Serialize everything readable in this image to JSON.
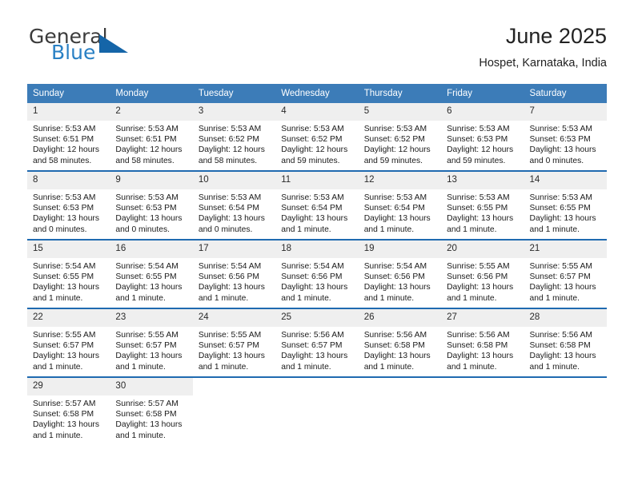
{
  "brand": {
    "name_top": "General",
    "name_bottom": "Blue",
    "triangle_icon": "brand-triangle-icon"
  },
  "header": {
    "title": "June 2025",
    "location": "Hospet, Karnataka, India"
  },
  "calendar": {
    "weekday_headers": [
      "Sunday",
      "Monday",
      "Tuesday",
      "Wednesday",
      "Thursday",
      "Friday",
      "Saturday"
    ],
    "colors": {
      "header_blue": "#3c7cb8",
      "separator_blue": "#1f6ab0",
      "daynum_band": "#efefef",
      "brand_blue": "#2980c4",
      "triangle_blue": "#1565a8"
    },
    "weeks": [
      [
        {
          "day": "1",
          "sunrise": "Sunrise: 5:53 AM",
          "sunset": "Sunset: 6:51 PM",
          "daylight_line1": "Daylight: 12 hours",
          "daylight_line2": "and 58 minutes."
        },
        {
          "day": "2",
          "sunrise": "Sunrise: 5:53 AM",
          "sunset": "Sunset: 6:51 PM",
          "daylight_line1": "Daylight: 12 hours",
          "daylight_line2": "and 58 minutes."
        },
        {
          "day": "3",
          "sunrise": "Sunrise: 5:53 AM",
          "sunset": "Sunset: 6:52 PM",
          "daylight_line1": "Daylight: 12 hours",
          "daylight_line2": "and 58 minutes."
        },
        {
          "day": "4",
          "sunrise": "Sunrise: 5:53 AM",
          "sunset": "Sunset: 6:52 PM",
          "daylight_line1": "Daylight: 12 hours",
          "daylight_line2": "and 59 minutes."
        },
        {
          "day": "5",
          "sunrise": "Sunrise: 5:53 AM",
          "sunset": "Sunset: 6:52 PM",
          "daylight_line1": "Daylight: 12 hours",
          "daylight_line2": "and 59 minutes."
        },
        {
          "day": "6",
          "sunrise": "Sunrise: 5:53 AM",
          "sunset": "Sunset: 6:53 PM",
          "daylight_line1": "Daylight: 12 hours",
          "daylight_line2": "and 59 minutes."
        },
        {
          "day": "7",
          "sunrise": "Sunrise: 5:53 AM",
          "sunset": "Sunset: 6:53 PM",
          "daylight_line1": "Daylight: 13 hours",
          "daylight_line2": "and 0 minutes."
        }
      ],
      [
        {
          "day": "8",
          "sunrise": "Sunrise: 5:53 AM",
          "sunset": "Sunset: 6:53 PM",
          "daylight_line1": "Daylight: 13 hours",
          "daylight_line2": "and 0 minutes."
        },
        {
          "day": "9",
          "sunrise": "Sunrise: 5:53 AM",
          "sunset": "Sunset: 6:53 PM",
          "daylight_line1": "Daylight: 13 hours",
          "daylight_line2": "and 0 minutes."
        },
        {
          "day": "10",
          "sunrise": "Sunrise: 5:53 AM",
          "sunset": "Sunset: 6:54 PM",
          "daylight_line1": "Daylight: 13 hours",
          "daylight_line2": "and 0 minutes."
        },
        {
          "day": "11",
          "sunrise": "Sunrise: 5:53 AM",
          "sunset": "Sunset: 6:54 PM",
          "daylight_line1": "Daylight: 13 hours",
          "daylight_line2": "and 1 minute."
        },
        {
          "day": "12",
          "sunrise": "Sunrise: 5:53 AM",
          "sunset": "Sunset: 6:54 PM",
          "daylight_line1": "Daylight: 13 hours",
          "daylight_line2": "and 1 minute."
        },
        {
          "day": "13",
          "sunrise": "Sunrise: 5:53 AM",
          "sunset": "Sunset: 6:55 PM",
          "daylight_line1": "Daylight: 13 hours",
          "daylight_line2": "and 1 minute."
        },
        {
          "day": "14",
          "sunrise": "Sunrise: 5:53 AM",
          "sunset": "Sunset: 6:55 PM",
          "daylight_line1": "Daylight: 13 hours",
          "daylight_line2": "and 1 minute."
        }
      ],
      [
        {
          "day": "15",
          "sunrise": "Sunrise: 5:54 AM",
          "sunset": "Sunset: 6:55 PM",
          "daylight_line1": "Daylight: 13 hours",
          "daylight_line2": "and 1 minute."
        },
        {
          "day": "16",
          "sunrise": "Sunrise: 5:54 AM",
          "sunset": "Sunset: 6:55 PM",
          "daylight_line1": "Daylight: 13 hours",
          "daylight_line2": "and 1 minute."
        },
        {
          "day": "17",
          "sunrise": "Sunrise: 5:54 AM",
          "sunset": "Sunset: 6:56 PM",
          "daylight_line1": "Daylight: 13 hours",
          "daylight_line2": "and 1 minute."
        },
        {
          "day": "18",
          "sunrise": "Sunrise: 5:54 AM",
          "sunset": "Sunset: 6:56 PM",
          "daylight_line1": "Daylight: 13 hours",
          "daylight_line2": "and 1 minute."
        },
        {
          "day": "19",
          "sunrise": "Sunrise: 5:54 AM",
          "sunset": "Sunset: 6:56 PM",
          "daylight_line1": "Daylight: 13 hours",
          "daylight_line2": "and 1 minute."
        },
        {
          "day": "20",
          "sunrise": "Sunrise: 5:55 AM",
          "sunset": "Sunset: 6:56 PM",
          "daylight_line1": "Daylight: 13 hours",
          "daylight_line2": "and 1 minute."
        },
        {
          "day": "21",
          "sunrise": "Sunrise: 5:55 AM",
          "sunset": "Sunset: 6:57 PM",
          "daylight_line1": "Daylight: 13 hours",
          "daylight_line2": "and 1 minute."
        }
      ],
      [
        {
          "day": "22",
          "sunrise": "Sunrise: 5:55 AM",
          "sunset": "Sunset: 6:57 PM",
          "daylight_line1": "Daylight: 13 hours",
          "daylight_line2": "and 1 minute."
        },
        {
          "day": "23",
          "sunrise": "Sunrise: 5:55 AM",
          "sunset": "Sunset: 6:57 PM",
          "daylight_line1": "Daylight: 13 hours",
          "daylight_line2": "and 1 minute."
        },
        {
          "day": "24",
          "sunrise": "Sunrise: 5:55 AM",
          "sunset": "Sunset: 6:57 PM",
          "daylight_line1": "Daylight: 13 hours",
          "daylight_line2": "and 1 minute."
        },
        {
          "day": "25",
          "sunrise": "Sunrise: 5:56 AM",
          "sunset": "Sunset: 6:57 PM",
          "daylight_line1": "Daylight: 13 hours",
          "daylight_line2": "and 1 minute."
        },
        {
          "day": "26",
          "sunrise": "Sunrise: 5:56 AM",
          "sunset": "Sunset: 6:58 PM",
          "daylight_line1": "Daylight: 13 hours",
          "daylight_line2": "and 1 minute."
        },
        {
          "day": "27",
          "sunrise": "Sunrise: 5:56 AM",
          "sunset": "Sunset: 6:58 PM",
          "daylight_line1": "Daylight: 13 hours",
          "daylight_line2": "and 1 minute."
        },
        {
          "day": "28",
          "sunrise": "Sunrise: 5:56 AM",
          "sunset": "Sunset: 6:58 PM",
          "daylight_line1": "Daylight: 13 hours",
          "daylight_line2": "and 1 minute."
        }
      ],
      [
        {
          "day": "29",
          "sunrise": "Sunrise: 5:57 AM",
          "sunset": "Sunset: 6:58 PM",
          "daylight_line1": "Daylight: 13 hours",
          "daylight_line2": "and 1 minute."
        },
        {
          "day": "30",
          "sunrise": "Sunrise: 5:57 AM",
          "sunset": "Sunset: 6:58 PM",
          "daylight_line1": "Daylight: 13 hours",
          "daylight_line2": "and 1 minute."
        },
        {
          "day": "",
          "sunrise": "",
          "sunset": "",
          "daylight_line1": "",
          "daylight_line2": ""
        },
        {
          "day": "",
          "sunrise": "",
          "sunset": "",
          "daylight_line1": "",
          "daylight_line2": ""
        },
        {
          "day": "",
          "sunrise": "",
          "sunset": "",
          "daylight_line1": "",
          "daylight_line2": ""
        },
        {
          "day": "",
          "sunrise": "",
          "sunset": "",
          "daylight_line1": "",
          "daylight_line2": ""
        },
        {
          "day": "",
          "sunrise": "",
          "sunset": "",
          "daylight_line1": "",
          "daylight_line2": ""
        }
      ]
    ]
  }
}
